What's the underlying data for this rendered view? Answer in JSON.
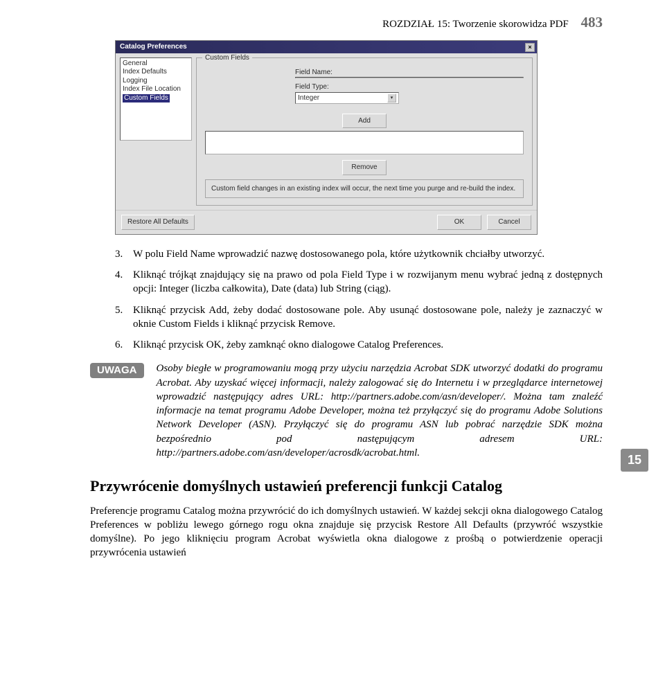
{
  "header": {
    "chapter_label": "ROZDZIAŁ 15:",
    "chapter_title": "Tworzenie skorowidza PDF",
    "page_number": "483"
  },
  "dialog": {
    "title": "Catalog Preferences",
    "list_items": [
      "General",
      "Index Defaults",
      "Logging",
      "Index File Location",
      "Custom Fields"
    ],
    "selected_item": "Custom Fields",
    "groupbox_title": "Custom Fields",
    "field_name_label": "Field Name:",
    "field_type_label": "Field Type:",
    "field_type_value": "Integer",
    "add_btn": "Add",
    "remove_btn": "Remove",
    "note_text": "Custom field changes in an existing index will occur, the next time you purge and re-build the index.",
    "restore_btn": "Restore All Defaults",
    "ok_btn": "OK",
    "cancel_btn": "Cancel"
  },
  "steps": [
    {
      "num": "3.",
      "text": "W polu Field Name wprowadzić nazwę dostosowanego pola, które użytkownik chciałby utworzyć."
    },
    {
      "num": "4.",
      "text": "Kliknąć trójkąt znajdujący się na prawo od pola Field Type i w rozwijanym menu wybrać jedną z dostępnych opcji: Integer (liczba całkowita), Date (data) lub String (ciąg)."
    },
    {
      "num": "5.",
      "text": "Kliknąć przycisk Add, żeby dodać dostosowane pole. Aby usunąć dostosowane pole, należy je zaznaczyć w oknie Custom Fields i kliknąć przycisk Remove."
    },
    {
      "num": "6.",
      "text": "Kliknąć przycisk OK, żeby zamknąć okno dialogowe Catalog Preferences."
    }
  ],
  "uwaga": {
    "label": "UWAGA",
    "text": "Osoby biegłe w programowaniu mogą przy użyciu narzędzia Acrobat SDK utworzyć dodatki do programu Acrobat. Aby uzyskać więcej informacji, należy zalogować się do Internetu i w przeglądarce internetowej wprowadzić następujący adres URL: http://partners.adobe.com/asn/developer/. Można tam znaleźć informacje na temat programu Adobe Developer, można też przyłączyć się do programu Adobe Solutions Network Developer (ASN). Przyłączyć się do programu ASN lub pobrać narzędzie SDK można bezpośrednio pod następującym adresem URL: http://partners.adobe.com/asn/developer/acrosdk/acrobat.html."
  },
  "side_tab": "15",
  "section_heading": "Przywrócenie domyślnych ustawień preferencji funkcji Catalog",
  "section_para": "Preferencje programu Catalog można przywrócić do ich domyślnych ustawień. W każdej sekcji okna dialogowego Catalog Preferences w pobliżu lewego górnego rogu okna znajduje się przycisk Restore All Defaults (przywróć wszystkie domyślne). Po jego kliknięciu program Acrobat wyświetla okna dialogowe z prośbą o potwierdzenie operacji przywrócenia ustawień"
}
